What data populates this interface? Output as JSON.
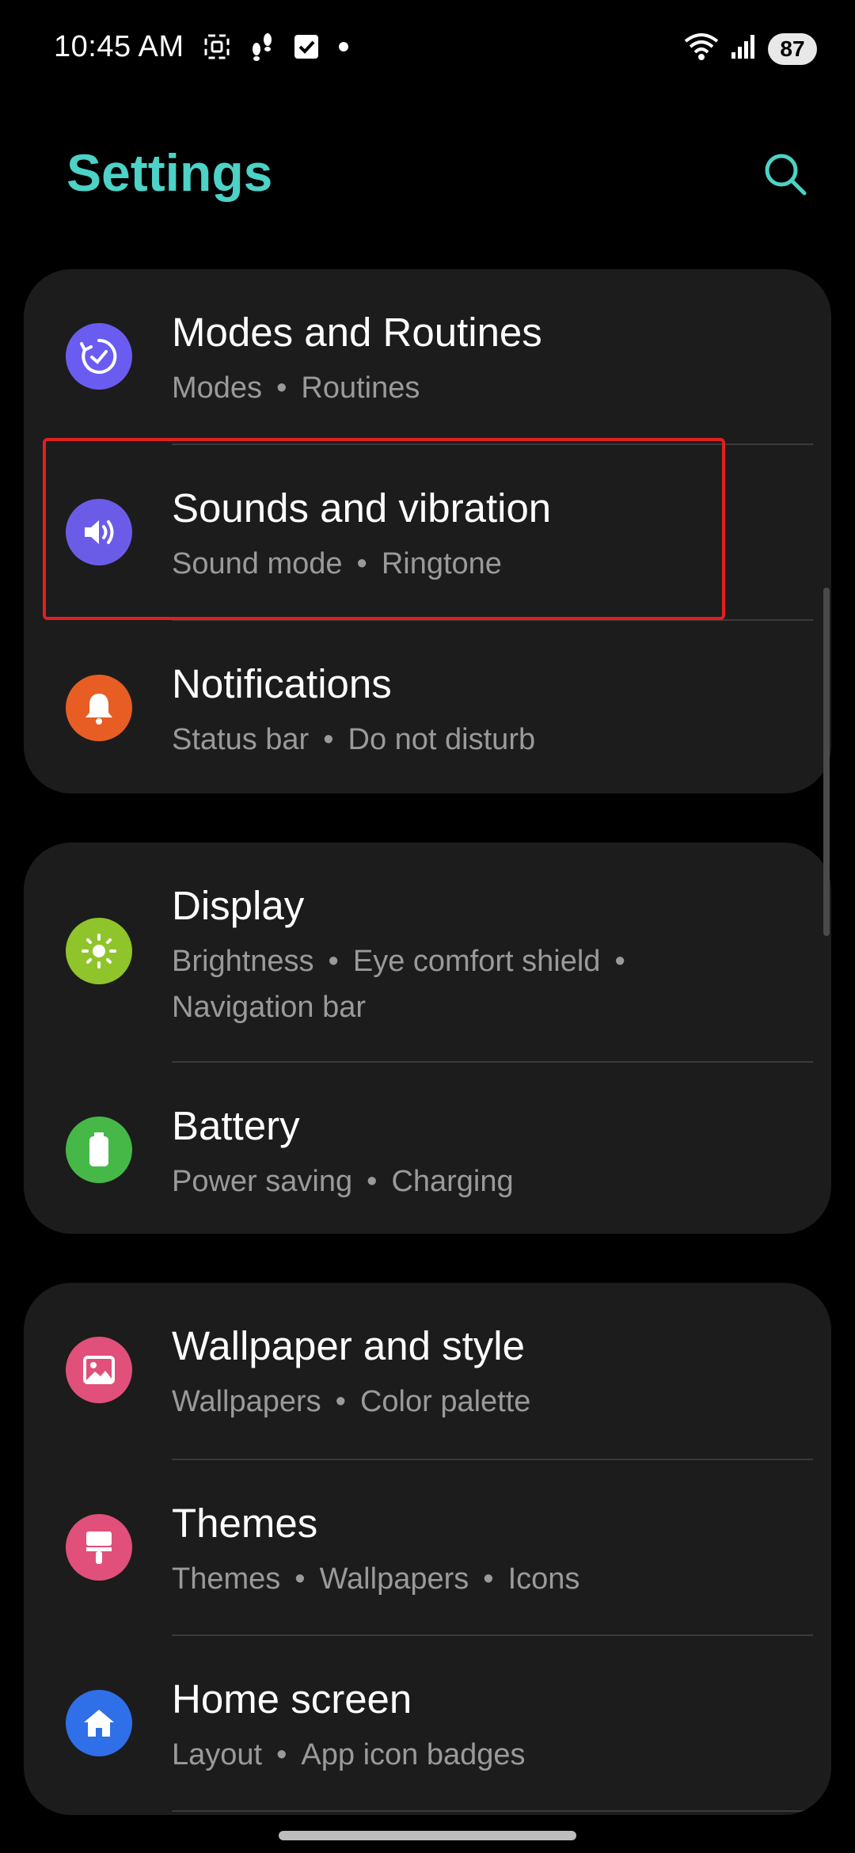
{
  "status_bar": {
    "time": "10:45 AM",
    "battery": "87",
    "icons_left": [
      "screenshot-icon",
      "footsteps-icon",
      "checkbox-icon",
      "dot-icon"
    ],
    "icons_right": [
      "wifi-icon",
      "signal-icon",
      "battery-icon"
    ]
  },
  "header": {
    "title": "Settings",
    "search_icon": "search-icon"
  },
  "colors": {
    "accent": "#4cd2c6",
    "card_bg": "#1c1c1c",
    "subtitle": "#9a9a9a",
    "highlight": "#e02020"
  },
  "groups": [
    {
      "items": [
        {
          "title": "Modes and Routines",
          "subs": [
            "Modes",
            "Routines"
          ],
          "icon": "routine-check-icon",
          "icon_color": "#6a5cf0"
        },
        {
          "title": "Sounds and vibration",
          "subs": [
            "Sound mode",
            "Ringtone"
          ],
          "icon": "speaker-icon",
          "icon_color": "#6b5ce8"
        },
        {
          "title": "Notifications",
          "subs": [
            "Status bar",
            "Do not disturb"
          ],
          "icon": "bell-icon",
          "icon_color": "#e85d24"
        }
      ]
    },
    {
      "items": [
        {
          "title": "Display",
          "subs": [
            "Brightness",
            "Eye comfort shield",
            "Navigation bar"
          ],
          "icon": "sun-icon",
          "icon_color": "#8fc52a"
        },
        {
          "title": "Battery",
          "subs": [
            "Power saving",
            "Charging"
          ],
          "icon": "battery-icon",
          "icon_color": "#45b848"
        }
      ]
    },
    {
      "items": [
        {
          "title": "Wallpaper and style",
          "subs": [
            "Wallpapers",
            "Color palette"
          ],
          "icon": "image-icon",
          "icon_color": "#e0507a"
        },
        {
          "title": "Themes",
          "subs": [
            "Themes",
            "Wallpapers",
            "Icons"
          ],
          "icon": "brush-icon",
          "icon_color": "#e0507a"
        },
        {
          "title": "Home screen",
          "subs": [
            "Layout",
            "App icon badges"
          ],
          "icon": "home-icon",
          "icon_color": "#2f6fe8"
        }
      ]
    }
  ]
}
